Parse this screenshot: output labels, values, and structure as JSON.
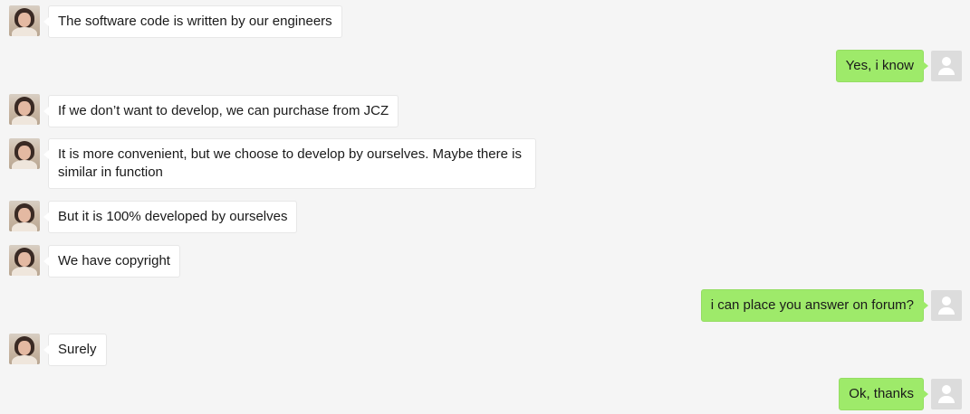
{
  "colors": {
    "background": "#f5f5f5",
    "incoming_bubble": "#ffffff",
    "outgoing_bubble": "#9eea6a",
    "default_avatar": "#dcdcdc"
  },
  "messages": [
    {
      "direction": "incoming",
      "avatar": "contact-photo-avatar",
      "text": "The software code is written by our engineers"
    },
    {
      "direction": "outgoing",
      "avatar": "default-user-avatar-icon",
      "text": "Yes, i know"
    },
    {
      "direction": "incoming",
      "avatar": "contact-photo-avatar",
      "text": "If we don’t want to develop, we can purchase from JCZ"
    },
    {
      "direction": "incoming",
      "avatar": "contact-photo-avatar",
      "text": "It is more convenient, but we choose to develop by ourselves. Maybe there is similar in function"
    },
    {
      "direction": "incoming",
      "avatar": "contact-photo-avatar",
      "text": "But it is 100% developed by ourselves"
    },
    {
      "direction": "incoming",
      "avatar": "contact-photo-avatar",
      "text": "We have copyright"
    },
    {
      "direction": "outgoing",
      "avatar": "default-user-avatar-icon",
      "text": "i can place you answer on forum?"
    },
    {
      "direction": "incoming",
      "avatar": "contact-photo-avatar",
      "text": "Surely"
    },
    {
      "direction": "outgoing",
      "avatar": "default-user-avatar-icon",
      "text": "Ok, thanks"
    }
  ]
}
